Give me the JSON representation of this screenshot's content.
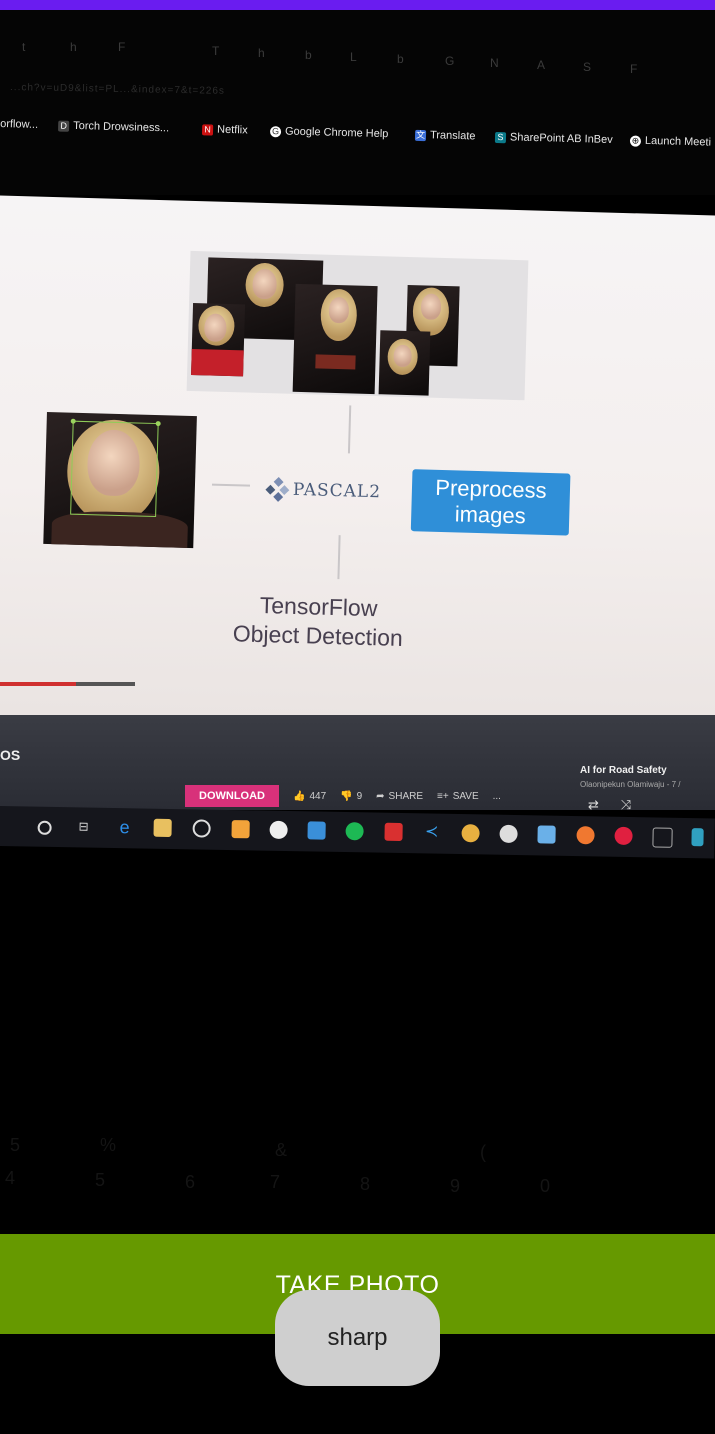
{
  "status_bar": {
    "color": "#6a1cf0"
  },
  "viewfinder": {
    "browser": {
      "tab_glyphs": [
        "t",
        "h",
        "F",
        "T",
        "h",
        "b",
        "L",
        "b",
        "G",
        "N",
        "A",
        "S",
        "F"
      ],
      "url_text": "...ch?v=uD9&list=PL...&index=7&t=226s",
      "bookmarks": [
        {
          "icon": "bookmark-icon",
          "label": "orflow..."
        },
        {
          "icon": "document-icon",
          "label": "Torch Drowsiness..."
        },
        {
          "icon": "netflix-icon",
          "label": "Netflix"
        },
        {
          "icon": "google-icon",
          "label": "Google Chrome Help"
        },
        {
          "icon": "translate-icon",
          "label": "Translate"
        },
        {
          "icon": "sharepoint-icon",
          "label": "SharePoint AB InBev"
        },
        {
          "icon": "launch-icon",
          "label": "Launch Meeti"
        }
      ]
    },
    "slide": {
      "pascal_label": "PASCAL2",
      "preprocess_label": [
        "Preprocess",
        "images"
      ],
      "tf_label": [
        "TensorFlow",
        "Object Detection"
      ]
    },
    "video": {
      "progress": 0.56
    },
    "youtube": {
      "title_fragment": "OS",
      "download_label": "DOWNLOAD",
      "like_count": "447",
      "dislike_count": "9",
      "share_label": "SHARE",
      "save_label": "SAVE",
      "more_label": "...",
      "playlist_title": "AI for Road Safety",
      "playlist_sub": "Olaonipekun Olamiwaju - 7 /"
    },
    "taskbar": {
      "icons": [
        "search-icon",
        "task-view-icon",
        "edge-icon",
        "folder-icon",
        "media-icon",
        "sublime-icon",
        "app-icon",
        "app-icon",
        "spotify-icon",
        "app-icon",
        "vscode-icon",
        "chrome-icon",
        "app-icon",
        "app-icon",
        "app-icon",
        "app-icon",
        "app-icon",
        "app-icon"
      ]
    }
  },
  "actions": {
    "take_photo_label": "TAKE PHOTO",
    "toast_label": "sharp",
    "button_color": "#669900"
  }
}
